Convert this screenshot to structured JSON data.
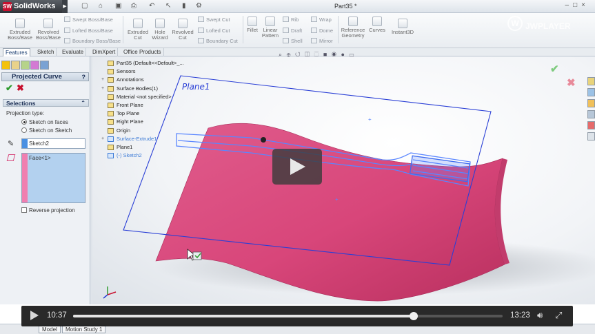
{
  "app": {
    "name": "SolidWorks",
    "logo_mark": "SW",
    "document_title": "Part35 *"
  },
  "quick_access": [
    "new-icon",
    "open-icon",
    "save-icon",
    "print-icon",
    "undo-icon",
    "select-icon",
    "rebuild-icon",
    "options-icon"
  ],
  "watermark": {
    "text": "JWPLAYER",
    "mark": "W"
  },
  "ribbon": {
    "extruded_boss": "Extruded Boss/Base",
    "revolved_boss": "Revolved Boss/Base",
    "swept_boss": "Swept Boss/Base",
    "lofted_boss": "Lofted Boss/Base",
    "boundary_boss": "Boundary Boss/Base",
    "extruded_cut": "Extruded Cut",
    "hole_wizard": "Hole Wizard",
    "revolved_cut": "Revolved Cut",
    "swept_cut": "Swept Cut",
    "lofted_cut": "Lofted Cut",
    "boundary_cut": "Boundary Cut",
    "fillet": "Fillet",
    "linear_pattern": "Linear Pattern",
    "rib": "Rib",
    "draft": "Draft",
    "shell": "Shell",
    "wrap": "Wrap",
    "dome": "Dome",
    "mirror": "Mirror",
    "reference_geometry": "Reference Geometry",
    "curves": "Curves",
    "instant3d": "Instant3D"
  },
  "tabs": [
    "Features",
    "Sketch",
    "Evaluate",
    "DimXpert",
    "Office Products"
  ],
  "property_manager": {
    "title": "Projected Curve",
    "help": "?",
    "selections_label": "Selections",
    "projection_type_label": "Projection type:",
    "option_faces": "Sketch on faces",
    "option_sketch": "Sketch on Sketch",
    "selected_option": "Sketch on faces",
    "sketch_value": "Sketch2",
    "face_value": "Face<1>",
    "reverse_label": "Reverse projection",
    "reverse_checked": false
  },
  "feature_tree": [
    {
      "label": "Part35  (Default<<Default>_...",
      "state": "normal"
    },
    {
      "label": "Sensors",
      "state": "normal"
    },
    {
      "label": "Annotations",
      "state": "normal"
    },
    {
      "label": "Surface Bodies(1)",
      "state": "normal"
    },
    {
      "label": "Material <not specified>",
      "state": "normal"
    },
    {
      "label": "Front Plane",
      "state": "normal"
    },
    {
      "label": "Top Plane",
      "state": "normal"
    },
    {
      "label": "Right Plane",
      "state": "normal"
    },
    {
      "label": "Origin",
      "state": "normal"
    },
    {
      "label": "Surface-Extrude1",
      "state": "highlighted"
    },
    {
      "label": "Plane1",
      "state": "normal"
    },
    {
      "label": "(-) Sketch2",
      "state": "highlighted"
    }
  ],
  "viewport": {
    "plane_label": "Plane1"
  },
  "bottom_tabs": [
    "Model",
    "Motion Study 1"
  ],
  "player": {
    "current_time": "10:37",
    "duration": "13:23",
    "progress": 0.793
  },
  "colors": {
    "surface": "#d8467a",
    "plane_outline": "#2a3fd6",
    "sketch": "#5a86ff",
    "player_bg": "#191919"
  }
}
